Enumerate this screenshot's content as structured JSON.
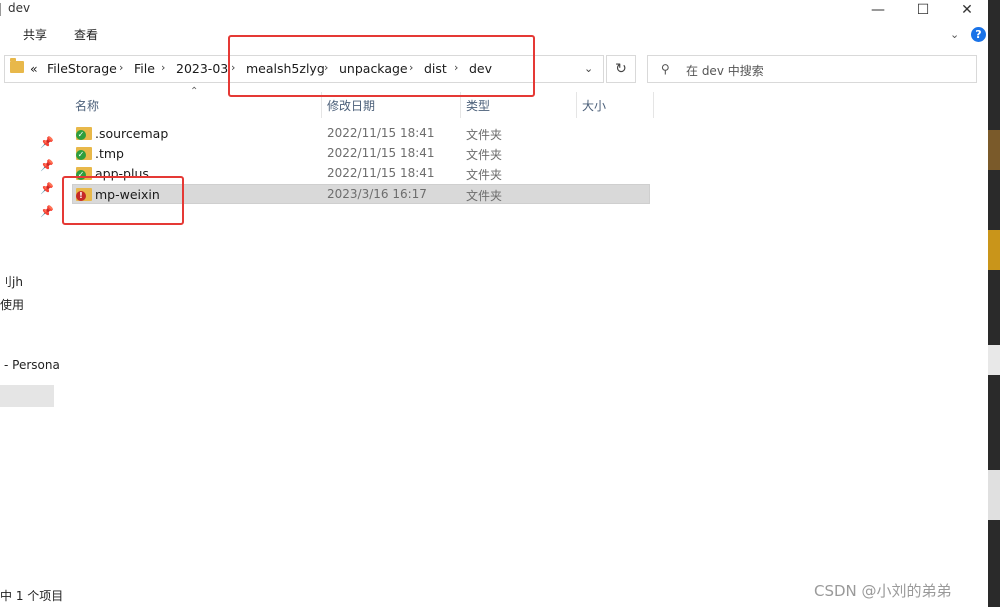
{
  "window": {
    "title": "dev",
    "controls": {
      "minimize": "—",
      "maximize": "☐",
      "close": "✕"
    }
  },
  "ribbon": {
    "tabs": [
      "共享",
      "查看"
    ],
    "collapse_glyph": "⌄",
    "help_glyph": "?"
  },
  "address_bar": {
    "overflow": "«",
    "crumbs": [
      "FileStorage",
      "File",
      "2023-03",
      "mealsh5zlyg",
      "unpackage",
      "dist",
      "dev"
    ],
    "separator": "›"
  },
  "search": {
    "placeholder": "在 dev 中搜索",
    "icon": "search-icon"
  },
  "columns": [
    "名称",
    "修改日期",
    "类型",
    "大小"
  ],
  "files": [
    {
      "name": ".sourcemap",
      "modified": "2022/11/15 18:41",
      "type": "文件夹",
      "size": "",
      "status": "synced",
      "selected": false
    },
    {
      "name": ".tmp",
      "modified": "2022/11/15 18:41",
      "type": "文件夹",
      "size": "",
      "status": "synced",
      "selected": false
    },
    {
      "name": "app-plus",
      "modified": "2022/11/15 18:41",
      "type": "文件夹",
      "size": "",
      "status": "synced",
      "selected": false
    },
    {
      "name": "mp-weixin",
      "modified": "2023/3/16 16:17",
      "type": "文件夹",
      "size": "",
      "status": "error",
      "selected": true
    }
  ],
  "nav_pane": {
    "fragments": [
      "刂jh",
      "使用",
      "- Persona"
    ]
  },
  "status_bar": {
    "text": "中 1 个项目"
  },
  "watermark": "CSDN @小刘的弟弟",
  "colors": {
    "annotation": "#e53935",
    "folder": "#e8b84a",
    "synced": "#2e9e3e",
    "error": "#c62828",
    "selection": "#d9d9d9",
    "help": "#1a73e8"
  }
}
